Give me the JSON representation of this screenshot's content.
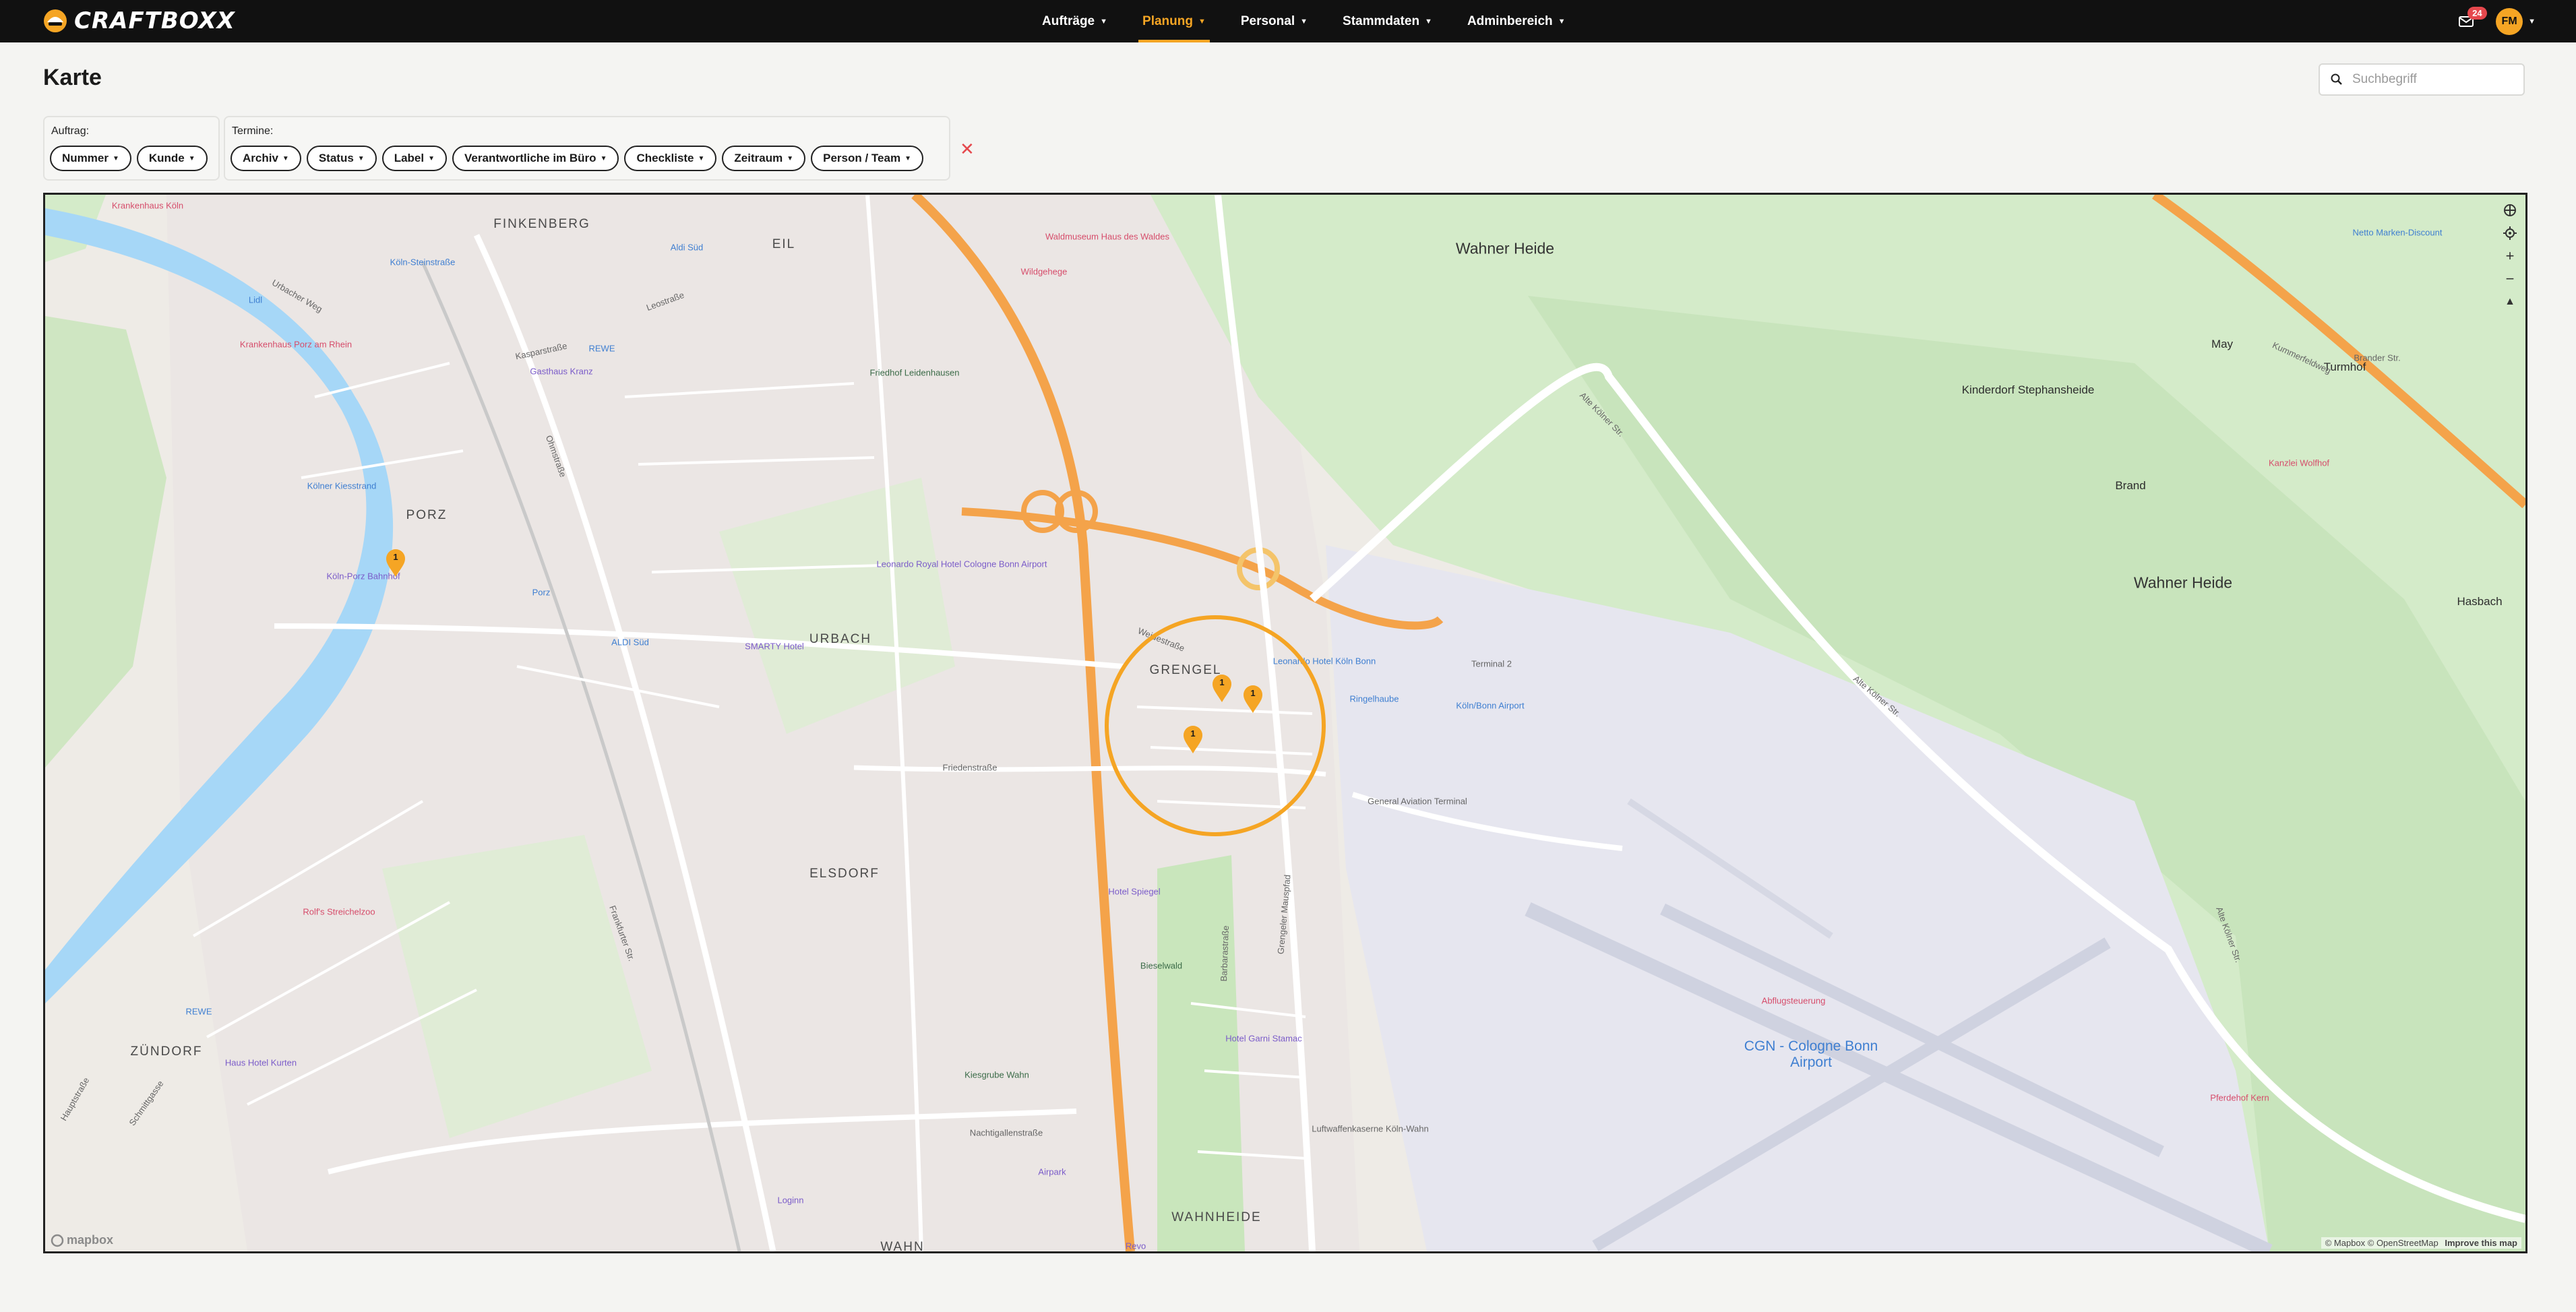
{
  "app": {
    "brand": "CRAFTBOXX"
  },
  "nav": {
    "items": [
      {
        "label": "Aufträge",
        "active": false
      },
      {
        "label": "Planung",
        "active": true
      },
      {
        "label": "Personal",
        "active": false
      },
      {
        "label": "Stammdaten",
        "active": false
      },
      {
        "label": "Adminbereich",
        "active": false
      }
    ],
    "notifications_count": "24",
    "user_initials": "FM"
  },
  "page": {
    "title": "Karte"
  },
  "search": {
    "placeholder": "Suchbegriff"
  },
  "filters": {
    "auftrag": {
      "label": "Auftrag:",
      "pills": [
        "Nummer",
        "Kunde"
      ]
    },
    "termine": {
      "label": "Termine:",
      "pills": [
        "Archiv",
        "Status",
        "Label",
        "Verantwortliche im Büro",
        "Checkliste",
        "Zeitraum",
        "Person / Team"
      ]
    }
  },
  "map": {
    "markers": [
      "1",
      "1",
      "1",
      "1"
    ],
    "labels": {
      "finkenberg": "FINKENBERG",
      "eil": "EIL",
      "porz": "PORZ",
      "urbach": "URBACH",
      "grengel": "GRENGEL",
      "elsdorf": "ELSDORF",
      "zundorf": "ZÜNDORF",
      "wahnheide": "WAHNHEIDE",
      "wahn": "WAHN",
      "wahner_heide_top": "Wahner Heide",
      "wahner_heide_right": "Wahner Heide",
      "kinderdorf": "Kinderdorf Stephansheide",
      "brand": "Brand",
      "turmhof": "Turmhof",
      "may": "May",
      "hasbach": "Hasbach",
      "krankenhaus_koln": "Krankenhaus Köln",
      "koln_steinstrasse": "Köln-Steinstraße",
      "aldi_sud_top": "Aldi Süd",
      "lidl": "Lidl",
      "krankenhaus_porz": "Krankenhaus Porz am Rhein",
      "rewe_top": "REWE",
      "gasthaus_kranz": "Gasthaus Kranz",
      "friedhof": "Friedhof Leidenhausen",
      "waldmuseum": "Waldmuseum Haus des Waldes",
      "wildgehege": "Wildgehege",
      "koln_porz_bahnhof": "Köln-Porz Bahnhof",
      "koln_kiesstrand": "Kölner Kiesstrand",
      "porz_station": "Porz",
      "aldi_sud": "ALDI Süd",
      "smarty_hotel": "SMARTY Hotel",
      "leonardo_royal": "Leonardo Royal Hotel Cologne Bonn Airport",
      "leonardo_hotel": "Leonardo Hotel Köln Bonn",
      "ringelhaube": "Ringelhaube",
      "terminal2": "Terminal 2",
      "koln_bonn_airport": "Köln/Bonn Airport",
      "general_aviation": "General Aviation Terminal",
      "hotel_spiegel": "Hotel Spiegel",
      "bieselwald": "Bieselwald",
      "hotel_garni": "Hotel Garni Stamac",
      "kiesgrube": "Kiesgrube Wahn",
      "luftwaffenkaserne": "Luftwaffenkaserne Köln-Wahn",
      "cgn": "CGN - Cologne Bonn Airport",
      "abflugsteuerung": "Abflugsteuerung",
      "rolfs": "Rolf's Streichelzoo",
      "rewe_bottom": "REWE",
      "haus_hotel": "Haus Hotel Kurten",
      "airpark": "Airpark",
      "loginn": "Loginn",
      "revo": "Revo",
      "netto": "Netto Marken-Discount",
      "kanzlei": "Kanzlei Wolfhof",
      "pferde": "Pferdehof Kern",
      "weidestrasse": "Weidestraße",
      "friedenstrasse": "Friedenstraße",
      "nachtigallenstrasse": "Nachtigallenstraße",
      "alte_kolner_str_1": "Alte Kölner Str.",
      "alte_kolner_str_2": "Alte Kölner Str.",
      "alte_kolner_str_3": "Alte Kölner Str.",
      "grengeler_mauspfad": "Grengeler Mauspfad",
      "barbarastrasse": "Barbarastraße",
      "hauptstrasse": "Hauptstraße",
      "schmittgasse": "Schmittgasse",
      "kasparstrasse": "Kasparstraße",
      "urbacher_weg": "Urbacher Weg",
      "leostrasse": "Leostraße",
      "ohmstrasse": "Ohmstraße",
      "frankfurter": "Frankfurter Str.",
      "brander_str": "Brander Str.",
      "kummerfeldweg": "Kummerfeldweg"
    },
    "attribution": "© Mapbox © OpenStreetMap",
    "improve_label": "Improve this map",
    "logo_text": "mapbox",
    "controls": [
      "compass",
      "locate",
      "zoom-in",
      "zoom-out",
      "north"
    ]
  },
  "colors": {
    "accent": "#f5a524",
    "nav_bg": "#111111",
    "water": "#a6d7f7",
    "green": "#cfe8c4",
    "highway": "#f4a34a"
  }
}
